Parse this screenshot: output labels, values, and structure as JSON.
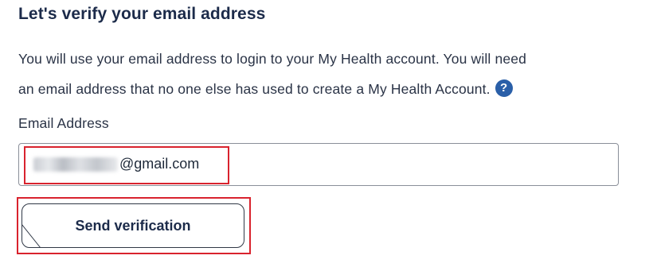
{
  "page": {
    "title": "Let's verify your email address",
    "description_line1": "You will use your email address to login to your My Health account. You will need",
    "description_line2": "an email address that no one else has used to create a My Health Account.",
    "help_icon": {
      "icon": "question-mark-icon",
      "glyph": "?",
      "color": "#2a5fa8"
    }
  },
  "email_field": {
    "label": "Email Address",
    "value_visible": "@gmail.com",
    "redacted_prefix": true
  },
  "send_button": {
    "label": "Send verification"
  },
  "annotation_color": "#d9232e"
}
